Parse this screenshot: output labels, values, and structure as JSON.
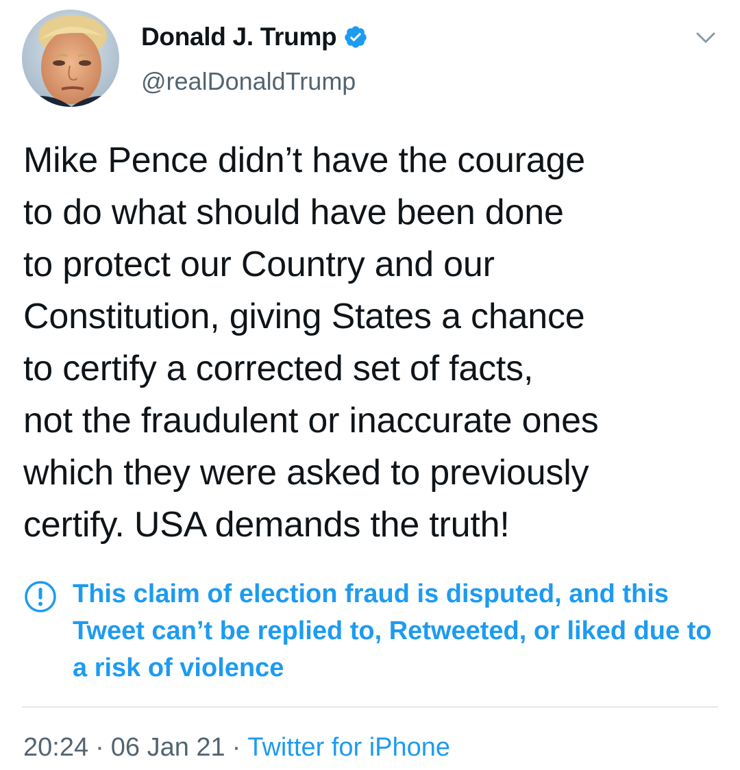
{
  "author": {
    "display_name": "Donald J. Trump",
    "handle": "@realDonaldTrump",
    "verified": true,
    "avatar_icon": "profile-photo"
  },
  "tweet": {
    "text": "Mike Pence didn’t have the courage\nto do what should have been done\nto protect our Country and our\nConstitution, giving States a chance\nto certify a corrected set of facts,\nnot the fraudulent or inaccurate ones\nwhich they were asked to previously\ncertify. USA demands the truth!"
  },
  "notice": {
    "icon": "exclamation-circle-icon",
    "text": "This claim of election fraud is disputed, and this Tweet can’t be replied to, Retweeted, or liked due to a risk of violence"
  },
  "meta": {
    "time": "20:24",
    "separator": "·",
    "date": "06 Jan 21",
    "source": "Twitter for iPhone"
  },
  "colors": {
    "accent": "#1d9bf0",
    "text": "#0f1419",
    "secondary": "#536471",
    "divider": "#e1e8ed"
  }
}
